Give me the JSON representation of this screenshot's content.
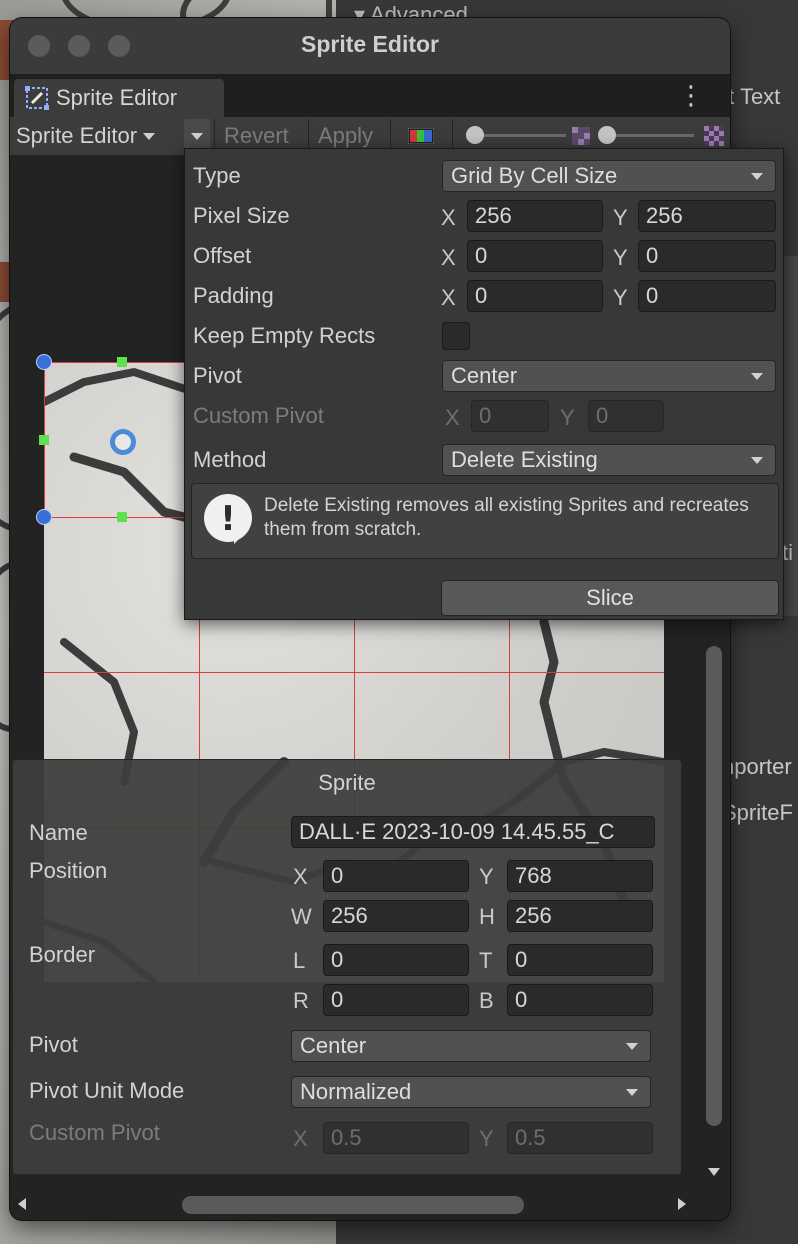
{
  "background": {
    "advanced_label": "Advanced",
    "right_text_1": "ıt Text",
    "right_text_2": "ti",
    "right_text_3": "nporter",
    "right_text_4": "SpriteF"
  },
  "window": {
    "title": "Sprite Editor",
    "tab_label": "Sprite Editor"
  },
  "toolbar": {
    "mode_label": "Sprite Editor",
    "revert_label": "Revert",
    "apply_label": "Apply"
  },
  "slice": {
    "type_label": "Type",
    "type_value": "Grid By Cell Size",
    "pixel_size_label": "Pixel Size",
    "pixel_size_x": "256",
    "pixel_size_y": "256",
    "offset_label": "Offset",
    "offset_x": "0",
    "offset_y": "0",
    "padding_label": "Padding",
    "padding_x": "0",
    "padding_y": "0",
    "keep_empty_label": "Keep Empty Rects",
    "pivot_label": "Pivot",
    "pivot_value": "Center",
    "custom_pivot_label": "Custom Pivot",
    "custom_pivot_x": "0",
    "custom_pivot_y": "0",
    "method_label": "Method",
    "method_value": "Delete Existing",
    "help_text": "Delete Existing removes all existing Sprites and recreates them from scratch.",
    "slice_button": "Slice",
    "axis_x": "X",
    "axis_y": "Y"
  },
  "sprite": {
    "panel_title": "Sprite",
    "name_label": "Name",
    "name_value": "DALL·E 2023-10-09 14.45.55_C",
    "position_label": "Position",
    "pos_x": "0",
    "pos_y": "768",
    "pos_w": "256",
    "pos_h": "256",
    "border_label": "Border",
    "border_l": "0",
    "border_t": "0",
    "border_r": "0",
    "border_b": "0",
    "pivot_label": "Pivot",
    "pivot_value": "Center",
    "pivot_unit_label": "Pivot Unit Mode",
    "pivot_unit_value": "Normalized",
    "custom_pivot_label": "Custom Pivot",
    "custom_pivot_x": "0.5",
    "custom_pivot_y": "0.5",
    "axis_x": "X",
    "axis_y": "Y",
    "axis_w": "W",
    "axis_h": "H",
    "axis_l": "L",
    "axis_t": "T",
    "axis_r": "R",
    "axis_b": "B"
  }
}
